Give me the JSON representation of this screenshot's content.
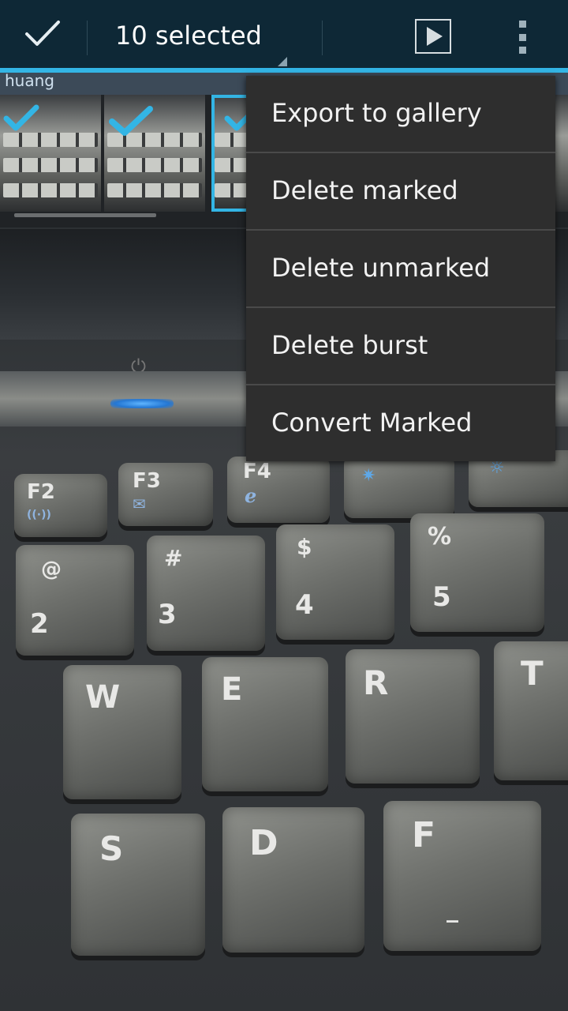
{
  "action_bar": {
    "done_icon": "check-icon",
    "title": "10 selected",
    "play_icon": "play-icon",
    "overflow_icon": "overflow-menu-icon",
    "accent": "#33b5e5",
    "background": "#0e2836"
  },
  "thumbnail_strip": {
    "banner_text": "huang",
    "thumbnails": [
      {
        "selected_checkmark": true,
        "highlighted": false
      },
      {
        "selected_checkmark": true,
        "highlighted": false
      },
      {
        "selected_checkmark": true,
        "highlighted": true
      }
    ]
  },
  "menu": {
    "items": [
      {
        "label": "Export to gallery"
      },
      {
        "label": "Delete marked"
      },
      {
        "label": "Delete unmarked"
      },
      {
        "label": "Delete burst"
      },
      {
        "label": "Convert Marked"
      }
    ]
  },
  "photo": {
    "keys": [
      {
        "main": "F2",
        "sub": "((·))"
      },
      {
        "main": "F3",
        "sub": "✉"
      },
      {
        "main": "F4",
        "sub": "ℯ"
      },
      {
        "main": "✷",
        "sub": ""
      },
      {
        "main": "@",
        "sub": "2"
      },
      {
        "main": "#",
        "sub": "3"
      },
      {
        "main": "$",
        "sub": "4"
      },
      {
        "main": "%",
        "sub": "5"
      },
      {
        "main": "W",
        "sub": ""
      },
      {
        "main": "E",
        "sub": ""
      },
      {
        "main": "R",
        "sub": ""
      },
      {
        "main": "T",
        "sub": ""
      },
      {
        "main": "S",
        "sub": ""
      },
      {
        "main": "D",
        "sub": ""
      },
      {
        "main": "F",
        "sub": "_"
      },
      {
        "main": "⏻",
        "sub": ""
      }
    ]
  }
}
